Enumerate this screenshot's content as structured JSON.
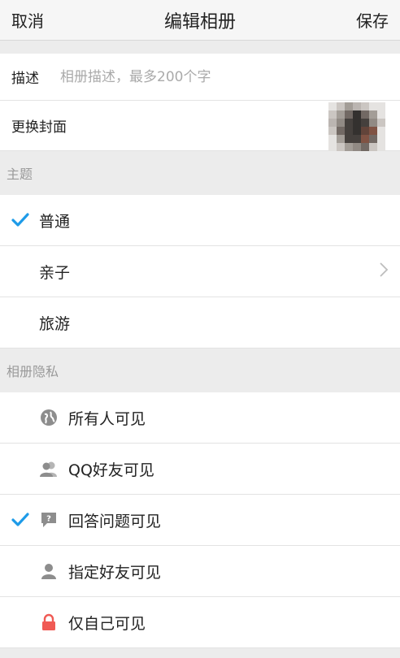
{
  "header": {
    "cancel_label": "取消",
    "title": "编辑相册",
    "save_label": "保存"
  },
  "description": {
    "label": "描述",
    "value": "",
    "placeholder": "相册描述，最多200个字"
  },
  "cover": {
    "label": "更换封面"
  },
  "theme": {
    "section_title": "主题",
    "options": [
      {
        "label": "普通",
        "selected": true,
        "has_chevron": false
      },
      {
        "label": "亲子",
        "selected": false,
        "has_chevron": true
      },
      {
        "label": "旅游",
        "selected": false,
        "has_chevron": false
      }
    ]
  },
  "privacy": {
    "section_title": "相册隐私",
    "options": [
      {
        "label": "所有人可见",
        "icon": "globe-icon",
        "selected": false
      },
      {
        "label": "QQ好友可见",
        "icon": "friends-icon",
        "selected": false
      },
      {
        "label": "回答问题可见",
        "icon": "question-icon",
        "selected": true
      },
      {
        "label": "指定好友可见",
        "icon": "person-icon",
        "selected": false
      },
      {
        "label": "仅自己可见",
        "icon": "lock-icon",
        "selected": false
      }
    ]
  },
  "colors": {
    "accent_check": "#1e9be8",
    "lock_red": "#f05a54",
    "icon_gray": "#8d8d8d",
    "placeholder_gray": "#aaaaaa",
    "section_text": "#9a9a9a"
  }
}
